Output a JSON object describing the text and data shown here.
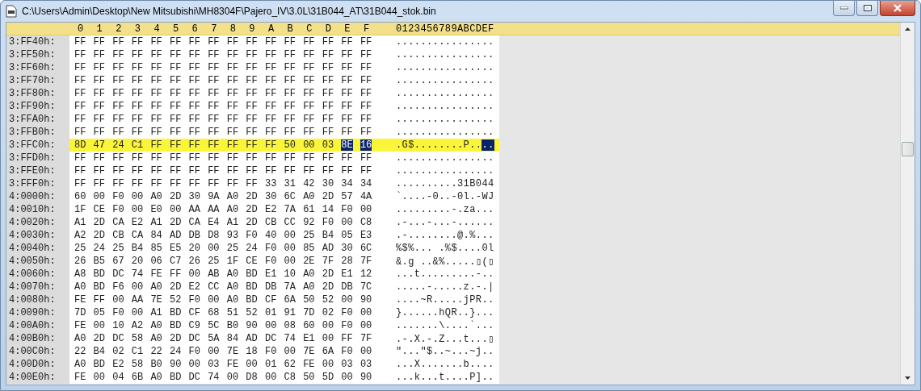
{
  "window": {
    "title": "C:\\Users\\Admin\\Desktop\\New Mitsubishi\\MH8304F\\Pajero_IV\\3.0L\\31B044_AT\\31B044_stok.bin"
  },
  "columns": [
    "0",
    "1",
    "2",
    "3",
    "4",
    "5",
    "6",
    "7",
    "8",
    "9",
    "A",
    "B",
    "C",
    "D",
    "E",
    "F"
  ],
  "ascii_header": "0123456789ABCDEF",
  "rows": [
    {
      "offset": "3:FF40h:",
      "bytes": [
        "FF",
        "FF",
        "FF",
        "FF",
        "FF",
        "FF",
        "FF",
        "FF",
        "FF",
        "FF",
        "FF",
        "FF",
        "FF",
        "FF",
        "FF",
        "FF"
      ],
      "ascii": "................",
      "highlighted": false
    },
    {
      "offset": "3:FF50h:",
      "bytes": [
        "FF",
        "FF",
        "FF",
        "FF",
        "FF",
        "FF",
        "FF",
        "FF",
        "FF",
        "FF",
        "FF",
        "FF",
        "FF",
        "FF",
        "FF",
        "FF"
      ],
      "ascii": "................",
      "highlighted": false
    },
    {
      "offset": "3:FF60h:",
      "bytes": [
        "FF",
        "FF",
        "FF",
        "FF",
        "FF",
        "FF",
        "FF",
        "FF",
        "FF",
        "FF",
        "FF",
        "FF",
        "FF",
        "FF",
        "FF",
        "FF"
      ],
      "ascii": "................",
      "highlighted": false
    },
    {
      "offset": "3:FF70h:",
      "bytes": [
        "FF",
        "FF",
        "FF",
        "FF",
        "FF",
        "FF",
        "FF",
        "FF",
        "FF",
        "FF",
        "FF",
        "FF",
        "FF",
        "FF",
        "FF",
        "FF"
      ],
      "ascii": "................",
      "highlighted": false
    },
    {
      "offset": "3:FF80h:",
      "bytes": [
        "FF",
        "FF",
        "FF",
        "FF",
        "FF",
        "FF",
        "FF",
        "FF",
        "FF",
        "FF",
        "FF",
        "FF",
        "FF",
        "FF",
        "FF",
        "FF"
      ],
      "ascii": "................",
      "highlighted": false
    },
    {
      "offset": "3:FF90h:",
      "bytes": [
        "FF",
        "FF",
        "FF",
        "FF",
        "FF",
        "FF",
        "FF",
        "FF",
        "FF",
        "FF",
        "FF",
        "FF",
        "FF",
        "FF",
        "FF",
        "FF"
      ],
      "ascii": "................",
      "highlighted": false
    },
    {
      "offset": "3:FFA0h:",
      "bytes": [
        "FF",
        "FF",
        "FF",
        "FF",
        "FF",
        "FF",
        "FF",
        "FF",
        "FF",
        "FF",
        "FF",
        "FF",
        "FF",
        "FF",
        "FF",
        "FF"
      ],
      "ascii": "................",
      "highlighted": false
    },
    {
      "offset": "3:FFB0h:",
      "bytes": [
        "FF",
        "FF",
        "FF",
        "FF",
        "FF",
        "FF",
        "FF",
        "FF",
        "FF",
        "FF",
        "FF",
        "FF",
        "FF",
        "FF",
        "FF",
        "FF"
      ],
      "ascii": "................",
      "highlighted": false
    },
    {
      "offset": "3:FFC0h:",
      "bytes": [
        "8D",
        "47",
        "24",
        "C1",
        "FF",
        "FF",
        "FF",
        "FF",
        "FF",
        "FF",
        "FF",
        "50",
        "00",
        "03"
      ],
      "ascii": ".G$........P..",
      "highlighted": true,
      "selection": {
        "bytes": [
          "8E",
          "16"
        ],
        "ascii": ".."
      }
    },
    {
      "offset": "3:FFD0h:",
      "bytes": [
        "FF",
        "FF",
        "FF",
        "FF",
        "FF",
        "FF",
        "FF",
        "FF",
        "FF",
        "FF",
        "FF",
        "FF",
        "FF",
        "FF",
        "FF",
        "FF"
      ],
      "ascii": "................",
      "highlighted": false
    },
    {
      "offset": "3:FFE0h:",
      "bytes": [
        "FF",
        "FF",
        "FF",
        "FF",
        "FF",
        "FF",
        "FF",
        "FF",
        "FF",
        "FF",
        "FF",
        "FF",
        "FF",
        "FF",
        "FF",
        "FF"
      ],
      "ascii": "................",
      "highlighted": false
    },
    {
      "offset": "3:FFF0h:",
      "bytes": [
        "FF",
        "FF",
        "FF",
        "FF",
        "FF",
        "FF",
        "FF",
        "FF",
        "FF",
        "FF",
        "33",
        "31",
        "42",
        "30",
        "34",
        "34"
      ],
      "ascii": "..........31B044",
      "highlighted": false
    },
    {
      "offset": "4:0000h:",
      "bytes": [
        "60",
        "00",
        "F0",
        "00",
        "A0",
        "2D",
        "30",
        "9A",
        "A0",
        "2D",
        "30",
        "6C",
        "A0",
        "2D",
        "57",
        "4A"
      ],
      "ascii": "`....-0..-0l.-WJ",
      "highlighted": false
    },
    {
      "offset": "4:0010h:",
      "bytes": [
        "1F",
        "CE",
        "F0",
        "00",
        "E0",
        "00",
        "AA",
        "AA",
        "A0",
        "2D",
        "E2",
        "7A",
        "61",
        "14",
        "F0",
        "00"
      ],
      "ascii": ".........-.za...",
      "highlighted": false
    },
    {
      "offset": "4:0020h:",
      "bytes": [
        "A1",
        "2D",
        "CA",
        "E2",
        "A1",
        "2D",
        "CA",
        "E4",
        "A1",
        "2D",
        "CB",
        "CC",
        "92",
        "F0",
        "00",
        "C8"
      ],
      "ascii": ".-...-...-......",
      "highlighted": false
    },
    {
      "offset": "4:0030h:",
      "bytes": [
        "A2",
        "2D",
        "CB",
        "CA",
        "84",
        "AD",
        "DB",
        "D8",
        "93",
        "F0",
        "40",
        "00",
        "25",
        "B4",
        "05",
        "E3"
      ],
      "ascii": ".-........@.%...",
      "highlighted": false
    },
    {
      "offset": "4:0040h:",
      "bytes": [
        "25",
        "24",
        "25",
        "B4",
        "85",
        "E5",
        "20",
        "00",
        "25",
        "24",
        "F0",
        "00",
        "85",
        "AD",
        "30",
        "6C"
      ],
      "ascii": "%$%... .%$....0l",
      "highlighted": false
    },
    {
      "offset": "4:0050h:",
      "bytes": [
        "26",
        "B5",
        "67",
        "20",
        "06",
        "C7",
        "26",
        "25",
        "1F",
        "CE",
        "F0",
        "00",
        "2E",
        "7F",
        "28",
        "7F"
      ],
      "ascii": "&.g ..&%.....▯(▯",
      "highlighted": false
    },
    {
      "offset": "4:0060h:",
      "bytes": [
        "A8",
        "BD",
        "DC",
        "74",
        "FE",
        "FF",
        "00",
        "AB",
        "A0",
        "BD",
        "E1",
        "10",
        "A0",
        "2D",
        "E1",
        "12"
      ],
      "ascii": "...t.........-..",
      "highlighted": false
    },
    {
      "offset": "4:0070h:",
      "bytes": [
        "A0",
        "BD",
        "F6",
        "00",
        "A0",
        "2D",
        "E2",
        "CC",
        "A0",
        "BD",
        "DB",
        "7A",
        "A0",
        "2D",
        "DB",
        "7C"
      ],
      "ascii": ".....-.....z.-.|",
      "highlighted": false
    },
    {
      "offset": "4:0080h:",
      "bytes": [
        "FE",
        "FF",
        "00",
        "AA",
        "7E",
        "52",
        "F0",
        "00",
        "A0",
        "BD",
        "CF",
        "6A",
        "50",
        "52",
        "00",
        "90"
      ],
      "ascii": "....~R.....jPR..",
      "highlighted": false
    },
    {
      "offset": "4:0090h:",
      "bytes": [
        "7D",
        "05",
        "F0",
        "00",
        "A1",
        "BD",
        "CF",
        "68",
        "51",
        "52",
        "01",
        "91",
        "7D",
        "02",
        "F0",
        "00"
      ],
      "ascii": "}......hQR..}...",
      "highlighted": false
    },
    {
      "offset": "4:00A0h:",
      "bytes": [
        "FE",
        "00",
        "10",
        "A2",
        "A0",
        "BD",
        "C9",
        "5C",
        "B0",
        "90",
        "00",
        "08",
        "60",
        "00",
        "F0",
        "00"
      ],
      "ascii": ".......\\....`...",
      "highlighted": false
    },
    {
      "offset": "4:00B0h:",
      "bytes": [
        "A0",
        "2D",
        "DC",
        "58",
        "A0",
        "2D",
        "DC",
        "5A",
        "84",
        "AD",
        "DC",
        "74",
        "E1",
        "00",
        "FF",
        "7F"
      ],
      "ascii": ".-.X.-.Z...t...▯",
      "highlighted": false
    },
    {
      "offset": "4:00C0h:",
      "bytes": [
        "22",
        "B4",
        "02",
        "C1",
        "22",
        "24",
        "F0",
        "00",
        "7E",
        "18",
        "F0",
        "00",
        "7E",
        "6A",
        "F0",
        "00"
      ],
      "ascii": "\"...\"$..~...~j..",
      "highlighted": false
    },
    {
      "offset": "4:00D0h:",
      "bytes": [
        "A0",
        "BD",
        "E2",
        "58",
        "B0",
        "90",
        "00",
        "03",
        "FE",
        "00",
        "01",
        "62",
        "FE",
        "00",
        "03",
        "03"
      ],
      "ascii": "...X.......b....",
      "highlighted": false
    },
    {
      "offset": "4:00E0h:",
      "bytes": [
        "FE",
        "00",
        "04",
        "6B",
        "A0",
        "BD",
        "DC",
        "74",
        "00",
        "D8",
        "00",
        "C8",
        "50",
        "5D",
        "00",
        "90"
      ],
      "ascii": "...k...t....P]..",
      "highlighted": false
    }
  ]
}
